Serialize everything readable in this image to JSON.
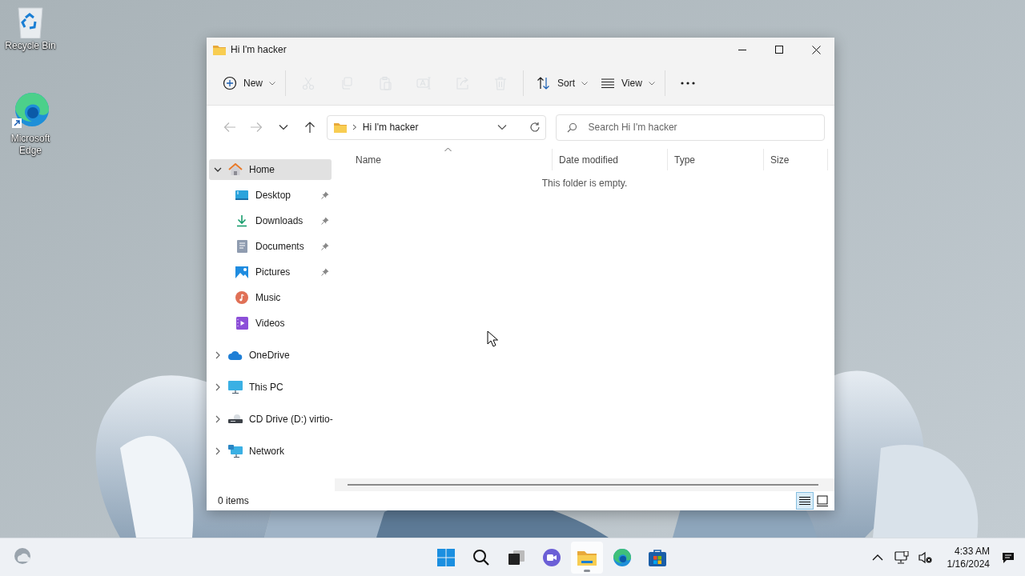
{
  "desktop_icons": [
    {
      "kind": "recycle",
      "label": "Recycle Bin"
    },
    {
      "kind": "edge",
      "label": "Microsoft Edge"
    }
  ],
  "window": {
    "title": "Hi I'm hacker"
  },
  "toolbar": [
    {
      "kind": "new",
      "label": "New",
      "disabled": false
    },
    {
      "kind": "cut",
      "disabled": true
    },
    {
      "kind": "copy",
      "disabled": true
    },
    {
      "kind": "paste",
      "disabled": true
    },
    {
      "kind": "rename",
      "disabled": true
    },
    {
      "kind": "share",
      "disabled": true
    },
    {
      "kind": "delete",
      "disabled": true
    },
    {
      "kind": "sort",
      "label": "Sort",
      "disabled": false
    },
    {
      "kind": "view",
      "label": "View",
      "disabled": false
    },
    {
      "kind": "more",
      "disabled": false
    }
  ],
  "nav_buttons": [
    {
      "kind": "back",
      "disabled": true
    },
    {
      "kind": "forward",
      "disabled": true
    },
    {
      "kind": "recent",
      "disabled": false
    },
    {
      "kind": "up",
      "disabled": false
    }
  ],
  "address": {
    "path": "Hi I'm hacker"
  },
  "search": {
    "placeholder": "Search Hi I'm hacker"
  },
  "sidebar": [
    {
      "kind": "home",
      "label": "Home",
      "expanded": true,
      "selected": true,
      "children": [
        {
          "kind": "desktop",
          "label": "Desktop",
          "pinned": true,
          "selected": false
        },
        {
          "kind": "downloads",
          "label": "Downloads",
          "pinned": true,
          "selected": false
        },
        {
          "kind": "documents",
          "label": "Documents",
          "pinned": true,
          "selected": false
        },
        {
          "kind": "pictures",
          "label": "Pictures",
          "pinned": true,
          "selected": false
        },
        {
          "kind": "music",
          "label": "Music",
          "pinned": false,
          "selected": false
        },
        {
          "kind": "videos",
          "label": "Videos",
          "pinned": false,
          "selected": false
        }
      ]
    },
    {
      "kind": "onedrive",
      "label": "OneDrive",
      "expanded": false,
      "selected": false
    },
    {
      "kind": "pc",
      "label": "This PC",
      "expanded": false,
      "selected": false
    },
    {
      "kind": "cd",
      "label": "CD Drive (D:) virtio-",
      "expanded": false,
      "selected": false
    },
    {
      "kind": "network",
      "label": "Network",
      "expanded": false,
      "selected": false
    }
  ],
  "columns": [
    {
      "label": "Name",
      "sorted": true
    },
    {
      "label": "Date modified",
      "sorted": false
    },
    {
      "label": "Type",
      "sorted": false
    },
    {
      "label": "Size",
      "sorted": false
    }
  ],
  "empty_message": "This folder is empty.",
  "status_bar": {
    "count": "0 items"
  },
  "view_buttons": [
    {
      "kind": "details",
      "selected": true
    },
    {
      "kind": "tiles",
      "selected": false
    }
  ],
  "taskbar": {
    "items": [
      {
        "kind": "start",
        "active": false
      },
      {
        "kind": "search",
        "active": false
      },
      {
        "kind": "taskview",
        "active": false
      },
      {
        "kind": "chat",
        "active": false
      },
      {
        "kind": "explorer",
        "active": true
      },
      {
        "kind": "edge",
        "active": false
      },
      {
        "kind": "store",
        "active": false
      }
    ],
    "tray": [
      {
        "kind": "chevron"
      },
      {
        "kind": "network"
      },
      {
        "kind": "volume"
      }
    ],
    "time": "4:33 AM",
    "date": "1/16/2024"
  }
}
